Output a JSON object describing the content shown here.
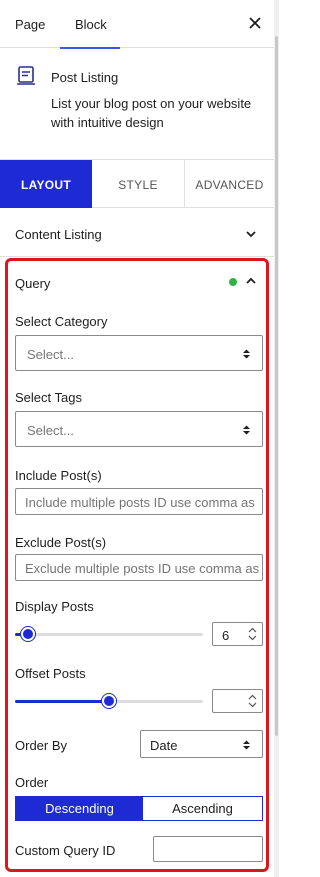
{
  "top_tabs": {
    "page": "Page",
    "block": "Block"
  },
  "block_card": {
    "title": "Post Listing",
    "description": "List your blog post on your website with intuitive design"
  },
  "panel_tabs": {
    "layout": "LAYOUT",
    "style": "STYLE",
    "advanced": "ADVANCED"
  },
  "content_listing": {
    "label": "Content Listing"
  },
  "query": {
    "label": "Query",
    "status_color": "#2fb344",
    "select_category": {
      "label": "Select Category",
      "placeholder": "Select..."
    },
    "select_tags": {
      "label": "Select Tags",
      "placeholder": "Select..."
    },
    "include_posts": {
      "label": "Include Post(s)",
      "placeholder": "Include multiple posts ID use comma as"
    },
    "exclude_posts": {
      "label": "Exclude Post(s)",
      "placeholder": "Exclude multiple posts ID use comma as"
    },
    "display_posts": {
      "label": "Display Posts",
      "value": "6",
      "slider_fraction": 0.07
    },
    "offset_posts": {
      "label": "Offset Posts",
      "value": "",
      "slider_fraction": 0.5
    },
    "order_by": {
      "label": "Order By",
      "value": "Date"
    },
    "order": {
      "label": "Order",
      "options": [
        "Descending",
        "Ascending"
      ],
      "selected": "Descending"
    },
    "custom_query_id": {
      "label": "Custom Query ID",
      "value": ""
    }
  },
  "accent_color": "#1e2ad4",
  "highlight_color": "#e0141e"
}
